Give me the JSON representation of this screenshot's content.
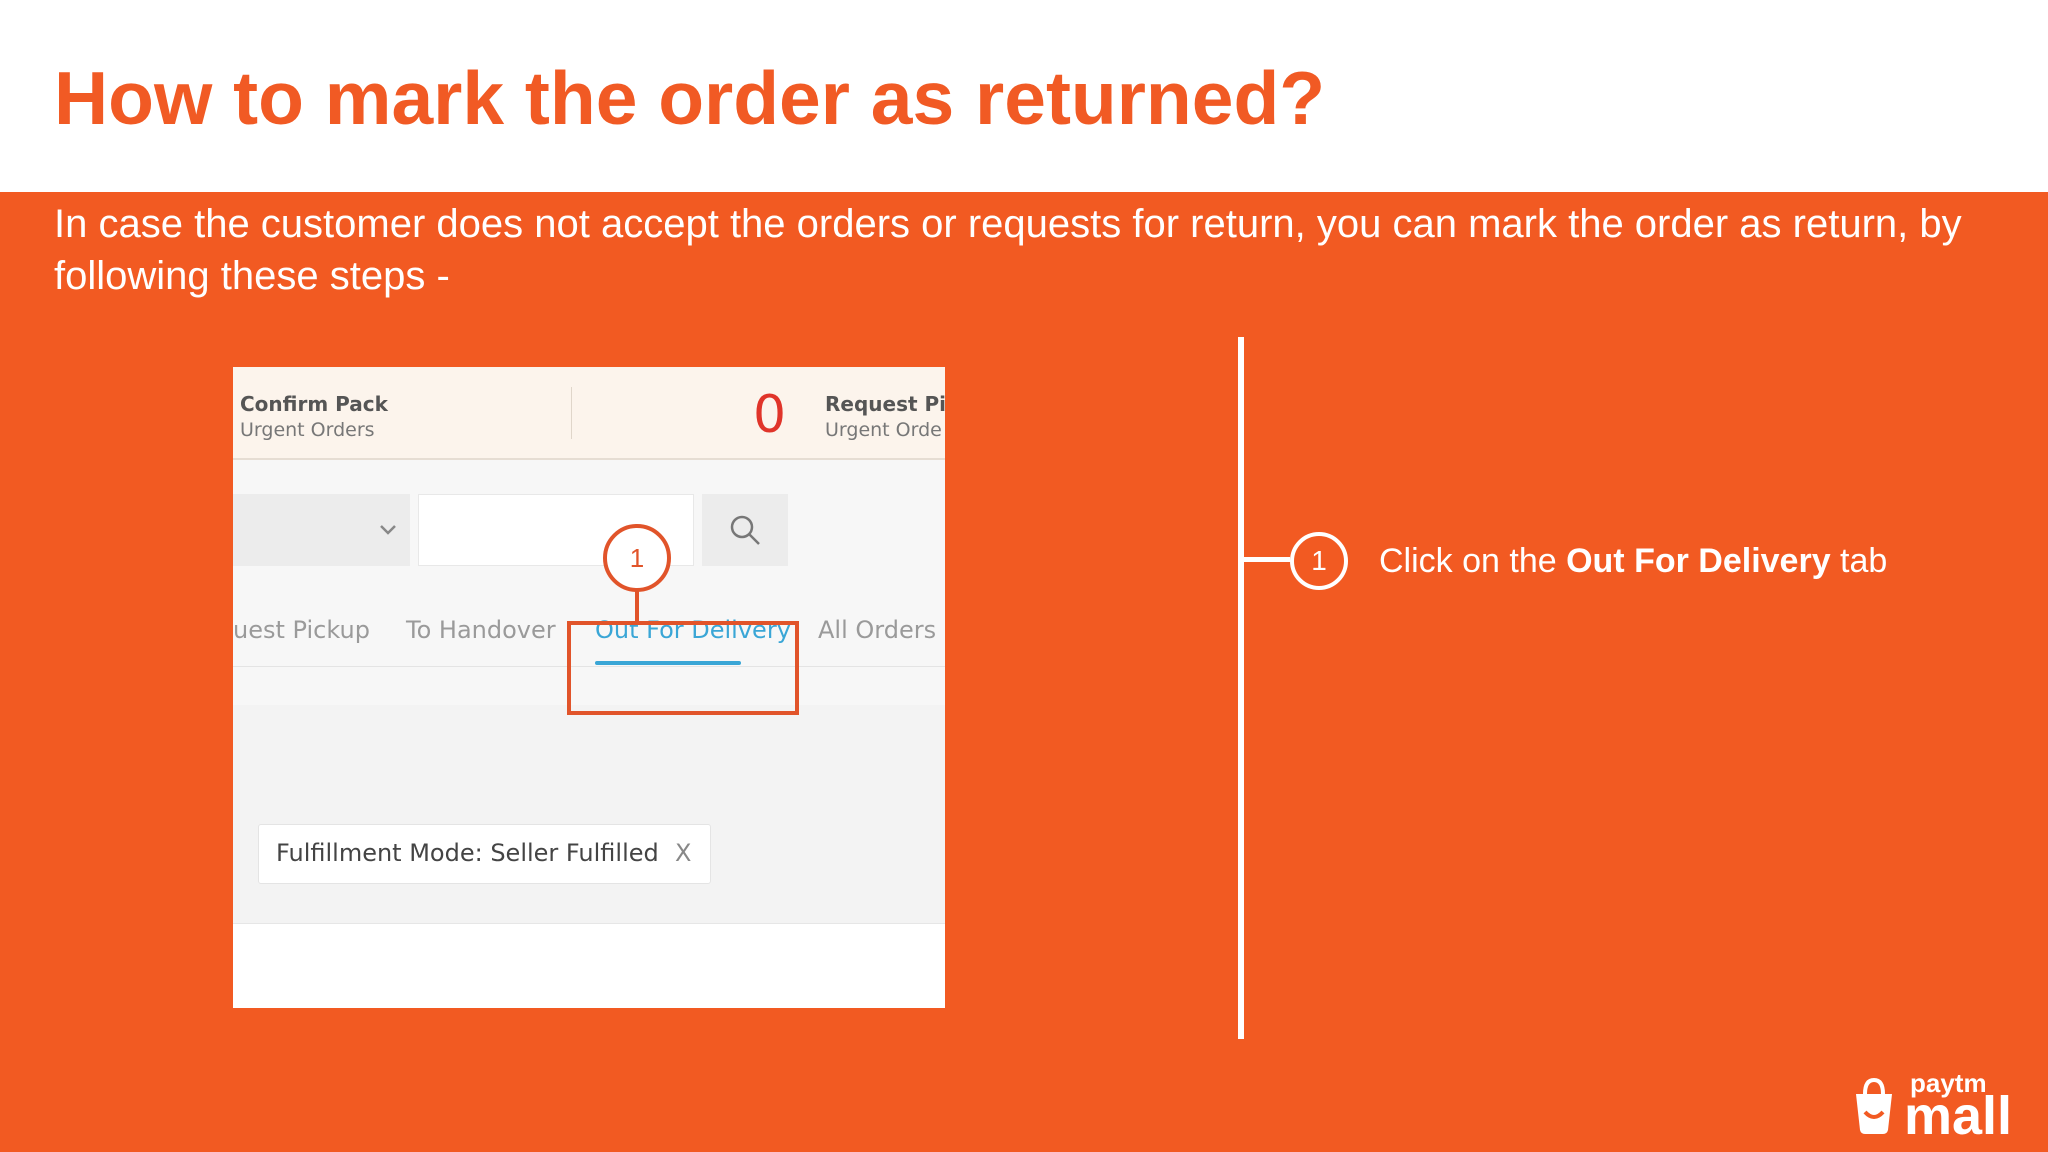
{
  "slide": {
    "title": "How to mark the order as returned?",
    "subtitle": "In case the customer does not accept the orders or requests for return, you can mark the order as return, by following these steps -"
  },
  "screenshot": {
    "stats": [
      {
        "label": "Confirm Pack",
        "sub": "Urgent Orders"
      },
      {
        "count": "0",
        "label": "Request Pic",
        "sub": "Urgent Orde"
      }
    ],
    "tabs": [
      {
        "label": "uest Pickup",
        "active": false
      },
      {
        "label": "To Handover",
        "active": false
      },
      {
        "label": "Out For Delivery",
        "active": true
      },
      {
        "label": "All Orders",
        "active": false
      }
    ],
    "filter_chip": {
      "text": "Fulfillment Mode: Seller Fulfilled",
      "close": "X"
    },
    "callout_number": "1"
  },
  "steps": [
    {
      "number": "1",
      "prefix": "Click on the ",
      "bold": "Out For Delivery",
      "suffix": " tab"
    }
  ],
  "logo": {
    "top": "paytm",
    "bottom": "mall"
  },
  "colors": {
    "brand_orange": "#f25a22",
    "active_tab": "#3aa6d6",
    "count_red": "#e0342a"
  }
}
